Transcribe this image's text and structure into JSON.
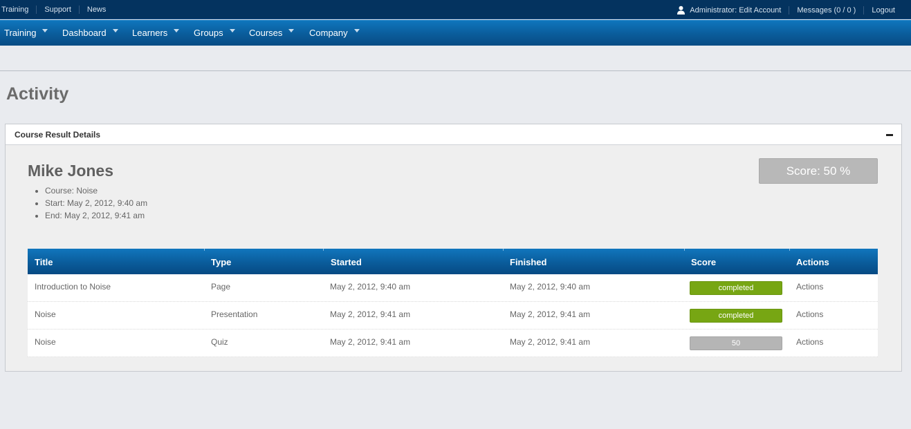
{
  "top_links": [
    "Training",
    "Support",
    "News"
  ],
  "account": {
    "edit_account": "Administrator: Edit Account",
    "messages": "Messages (0 / 0 )",
    "logout": "Logout"
  },
  "nav": [
    "Training",
    "Dashboard",
    "Learners",
    "Groups",
    "Courses",
    "Company"
  ],
  "page": {
    "title": "Activity"
  },
  "panel": {
    "title": "Course Result Details",
    "person": "Mike Jones",
    "details": [
      "Course: Noise",
      "Start: May 2, 2012, 9:40 am",
      "End: May 2, 2012, 9:41 am"
    ],
    "score": "Score: 50 %"
  },
  "table": {
    "headers": [
      "Title",
      "Type",
      "Started",
      "Finished",
      "Score",
      "Actions"
    ],
    "rows": [
      {
        "title": "Introduction to Noise",
        "type": "Page",
        "started": "May 2, 2012, 9:40 am",
        "finished": "May 2, 2012, 9:40 am",
        "score": "completed",
        "score_status": "completed",
        "actions": "Actions"
      },
      {
        "title": "Noise",
        "type": "Presentation",
        "started": "May 2, 2012, 9:41 am",
        "finished": "May 2, 2012, 9:41 am",
        "score": "completed",
        "score_status": "completed",
        "actions": "Actions"
      },
      {
        "title": "Noise",
        "type": "Quiz",
        "started": "May 2, 2012, 9:41 am",
        "finished": "May 2, 2012, 9:41 am",
        "score": "50",
        "score_status": "scored",
        "actions": "Actions"
      }
    ]
  },
  "colors": {
    "topbar": "#04335f",
    "nav": "#0a5a98",
    "completed": "#77a613",
    "score_neutral": "#b5b5b5"
  }
}
